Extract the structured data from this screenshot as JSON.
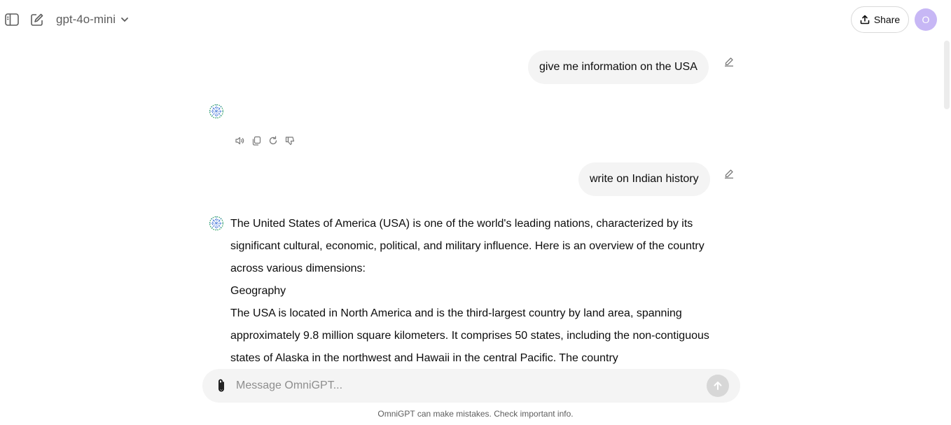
{
  "header": {
    "model_name": "gpt-4o-mini",
    "share_label": "Share",
    "avatar_initial": "O"
  },
  "conversation": {
    "messages": [
      {
        "role": "user",
        "text": "give me information on the USA"
      },
      {
        "role": "assistant",
        "text": ""
      },
      {
        "role": "user",
        "text": "write on Indian history"
      },
      {
        "role": "assistant",
        "paragraphs": [
          "The United States of America (USA) is one of the world's leading nations, characterized by its significant cultural, economic, political, and military influence. Here is an overview of the country across various dimensions:",
          "Geography",
          "The USA is located in North America and is the third-largest country by land area, spanning approximately 9.8 million square kilometers. It comprises 50 states, including the non-contiguous states of Alaska in the northwest and Hawaii in the central Pacific. The country"
        ]
      }
    ]
  },
  "composer": {
    "placeholder": "Message OmniGPT..."
  },
  "footer": {
    "disclaimer": "OmniGPT can make mistakes. Check important info."
  },
  "colors": {
    "avatar_bg": "#c7b7f5",
    "bubble_bg": "#f4f4f4",
    "send_disabled": "#d7d7d7",
    "bot_logo_green": "#3aa86b",
    "bot_logo_blue": "#3b6fd6"
  },
  "icons": {
    "sidebar_toggle": "sidebar-toggle-icon",
    "new_chat": "new-chat-icon",
    "model_dropdown": "chevron-down-icon",
    "share": "upload-icon",
    "edit": "pencil-icon",
    "read_aloud": "speaker-icon",
    "copy": "copy-icon",
    "regenerate": "refresh-icon",
    "dislike": "thumbs-down-icon",
    "attach": "paperclip-icon",
    "send": "arrow-up-icon"
  }
}
